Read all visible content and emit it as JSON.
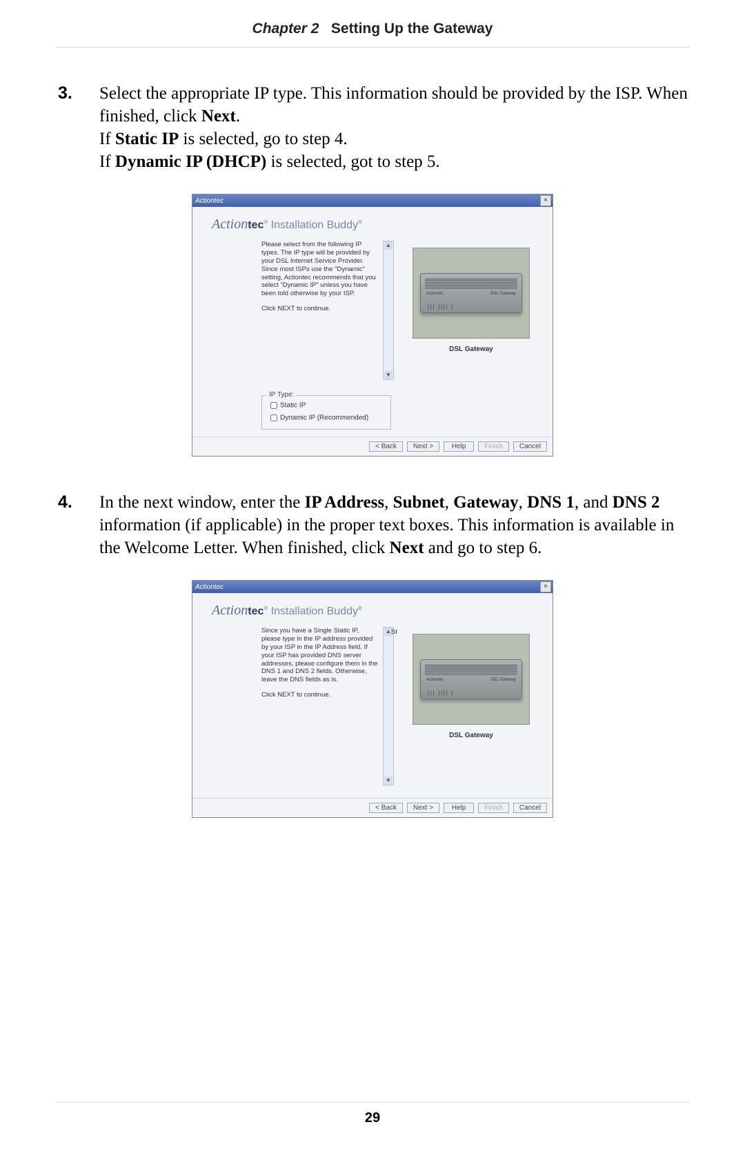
{
  "header": {
    "chapter": "Chapter 2",
    "title": "Setting Up the Gateway"
  },
  "steps": {
    "s3": {
      "num": "3.",
      "t1": "Select the appropriate IP type. This information should be provided by the ISP. When finished, click ",
      "t1b": "Next",
      "t1c": ".",
      "t2a": "If ",
      "t2b": "Static IP",
      "t2c": " is selected, go to step 4.",
      "t3a": "If ",
      "t3b": "Dynamic IP (DHCP)",
      "t3c": " is selected, got to step 5."
    },
    "s4": {
      "num": "4.",
      "t1a": "In the next window, enter the ",
      "t1b": "IP Address",
      "t1c": ", ",
      "t1d": "Subnet",
      "t1e": ", ",
      "t1f": "Gateway",
      "t1g": ", ",
      "t1h": "DNS 1",
      "t1i": ", and ",
      "t1j": "DNS 2",
      "t1k": " information (if applicable) in the proper text boxes. This information is available in the Welcome Letter. When finished, click ",
      "t1l": "Next",
      "t1m": " and go to step 6."
    }
  },
  "wizard": {
    "titlebar": "Actiontec",
    "brand_a": "Action",
    "brand_b": "tec",
    "brand_reg": "®",
    "brand_c": "Installation Buddy",
    "txt1_p1": "Please select from the following IP types. The IP type will be provided by your DSL Internet Service Provider. Since most ISPs use the \"Dynamic\" setting, Actiontec recommends that you select \"Dynamic IP\" unless you have been told otherwise by your ISP.",
    "txt1_p2": "Click NEXT to continue.",
    "txt2_p1": "Since you have a Single Static IP, please type in the IP address provided by your ISP in the IP Address field. If your ISP has provided DNS server addresses, please configure them in the DNS 1 and DNS 2 fields. Otherwise, leave the DNS fields as is.",
    "txt2_p2": "Click NEXT to continue.",
    "st_marker": "St",
    "device_brand": "Actiontec",
    "device_model": "DSL Gateway",
    "device_leds": "||| |||| |",
    "device_caption": "DSL Gateway",
    "iptype_legend": "IP Type:",
    "iptype_static": "Static IP",
    "iptype_dynamic": "Dynamic IP (Recommended)",
    "btn_back": "< Back",
    "btn_next": "Next >",
    "btn_help": "Help",
    "btn_finish": "Finish",
    "btn_cancel": "Cancel",
    "close": "×"
  },
  "footer": {
    "page": "29"
  }
}
